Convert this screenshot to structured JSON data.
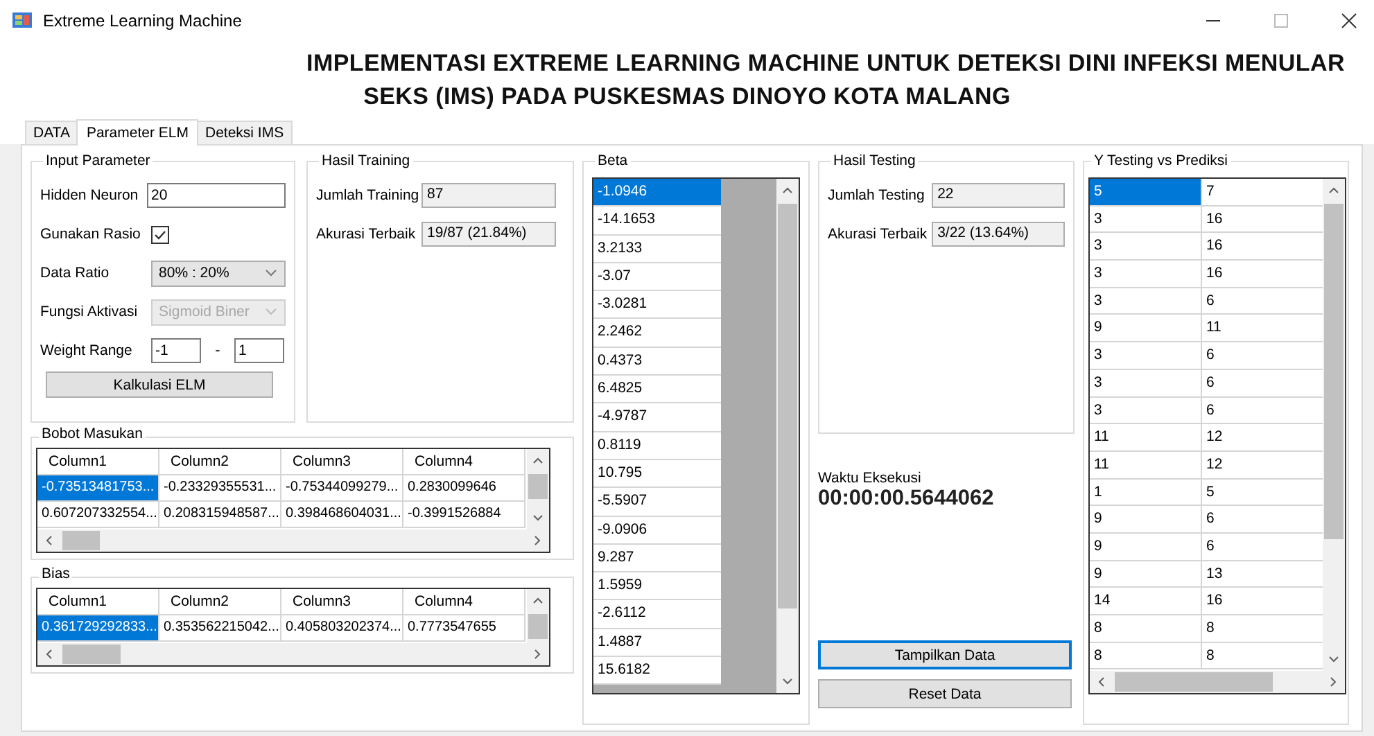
{
  "window": {
    "title": "Extreme Learning Machine"
  },
  "heading_lines": [
    "IMPLEMENTASI EXTREME LEARNING MACHINE UNTUK DETEKSI DINI INFEKSI MENULAR",
    "SEKS (IMS) PADA PUSKESMAS DINOYO KOTA MALANG"
  ],
  "tabs": [
    {
      "label": "DATA",
      "selected": false
    },
    {
      "label": "Parameter ELM",
      "selected": true
    },
    {
      "label": "Deteksi IMS",
      "selected": false
    }
  ],
  "input_parameter": {
    "title": "Input Parameter",
    "fields": [
      {
        "kind": "text",
        "label": "Hidden Neuron",
        "value": "20"
      },
      {
        "kind": "checkbox",
        "label": "Gunakan Rasio",
        "checked": true
      },
      {
        "kind": "select",
        "label": "Data Ratio",
        "value": "80% : 20%",
        "disabled": false
      },
      {
        "kind": "select",
        "label": "Fungsi Aktivasi",
        "value": "Sigmoid Biner",
        "disabled": true
      },
      {
        "kind": "range",
        "label": "Weight Range",
        "min": "-1",
        "separator": "-",
        "max": "1"
      }
    ],
    "button": "Kalkulasi ELM"
  },
  "hasil_training": {
    "title": "Hasil Training",
    "fields": [
      {
        "label": "Jumlah Training",
        "value": "87"
      },
      {
        "label": "Akurasi Terbaik",
        "value": "19/87 (21.84%)"
      }
    ]
  },
  "bobot_masukan": {
    "title": "Bobot Masukan",
    "columns": [
      "Column1",
      "Column2",
      "Column3",
      "Column4"
    ],
    "rows": [
      {
        "selected": true,
        "cells": [
          "-0.73513481753...",
          "-0.23329355531...",
          "-0.75344099279...",
          "0.2830099646"
        ]
      },
      {
        "selected": false,
        "cells": [
          "0.607207332554...",
          "0.208315948587...",
          "0.398468604031...",
          "-0.3991526884"
        ]
      }
    ]
  },
  "bias": {
    "title": "Bias",
    "columns": [
      "Column1",
      "Column2",
      "Column3",
      "Column4"
    ],
    "rows": [
      {
        "selected": true,
        "cells": [
          "0.361729292833...",
          "0.353562215042...",
          "0.405803202374...",
          "0.7773547655"
        ]
      }
    ]
  },
  "beta": {
    "title": "Beta",
    "items": [
      {
        "value": "-1.0946",
        "selected": true
      },
      {
        "value": "-14.1653",
        "selected": false
      },
      {
        "value": "3.2133",
        "selected": false
      },
      {
        "value": "-3.07",
        "selected": false
      },
      {
        "value": "-3.0281",
        "selected": false
      },
      {
        "value": "2.2462",
        "selected": false
      },
      {
        "value": "0.4373",
        "selected": false
      },
      {
        "value": "6.4825",
        "selected": false
      },
      {
        "value": "-4.9787",
        "selected": false
      },
      {
        "value": "0.8119",
        "selected": false
      },
      {
        "value": "10.795",
        "selected": false
      },
      {
        "value": "-5.5907",
        "selected": false
      },
      {
        "value": "-9.0906",
        "selected": false
      },
      {
        "value": "9.287",
        "selected": false
      },
      {
        "value": "1.5959",
        "selected": false
      },
      {
        "value": "-2.6112",
        "selected": false
      },
      {
        "value": "1.4887",
        "selected": false
      },
      {
        "value": "15.6182",
        "selected": false
      }
    ]
  },
  "hasil_testing": {
    "title": "Hasil Testing",
    "fields": [
      {
        "label": "Jumlah Testing",
        "value": "22"
      },
      {
        "label": "Akurasi Terbaik",
        "value": "3/22 (13.64%)"
      }
    ]
  },
  "waktu_eksekusi": {
    "label": "Waktu Eksekusi",
    "value": "00:00:00.5644062"
  },
  "buttons": [
    {
      "label": "Tampilkan Data",
      "focused": true
    },
    {
      "label": "Reset Data",
      "focused": false
    }
  ],
  "y_testing": {
    "title": "Y Testing vs Prediksi",
    "rows": [
      {
        "cells": [
          "5",
          "7"
        ],
        "selected": true
      },
      {
        "cells": [
          "3",
          "16"
        ],
        "selected": false
      },
      {
        "cells": [
          "3",
          "16"
        ],
        "selected": false
      },
      {
        "cells": [
          "3",
          "16"
        ],
        "selected": false
      },
      {
        "cells": [
          "3",
          "6"
        ],
        "selected": false
      },
      {
        "cells": [
          "9",
          "11"
        ],
        "selected": false
      },
      {
        "cells": [
          "3",
          "6"
        ],
        "selected": false
      },
      {
        "cells": [
          "3",
          "6"
        ],
        "selected": false
      },
      {
        "cells": [
          "3",
          "6"
        ],
        "selected": false
      },
      {
        "cells": [
          "11",
          "12"
        ],
        "selected": false
      },
      {
        "cells": [
          "11",
          "12"
        ],
        "selected": false
      },
      {
        "cells": [
          "1",
          "5"
        ],
        "selected": false
      },
      {
        "cells": [
          "9",
          "6"
        ],
        "selected": false
      },
      {
        "cells": [
          "9",
          "6"
        ],
        "selected": false
      },
      {
        "cells": [
          "9",
          "13"
        ],
        "selected": false
      },
      {
        "cells": [
          "14",
          "16"
        ],
        "selected": false
      },
      {
        "cells": [
          "8",
          "8"
        ],
        "selected": false
      },
      {
        "cells": [
          "8",
          "8"
        ],
        "selected": false
      }
    ]
  }
}
